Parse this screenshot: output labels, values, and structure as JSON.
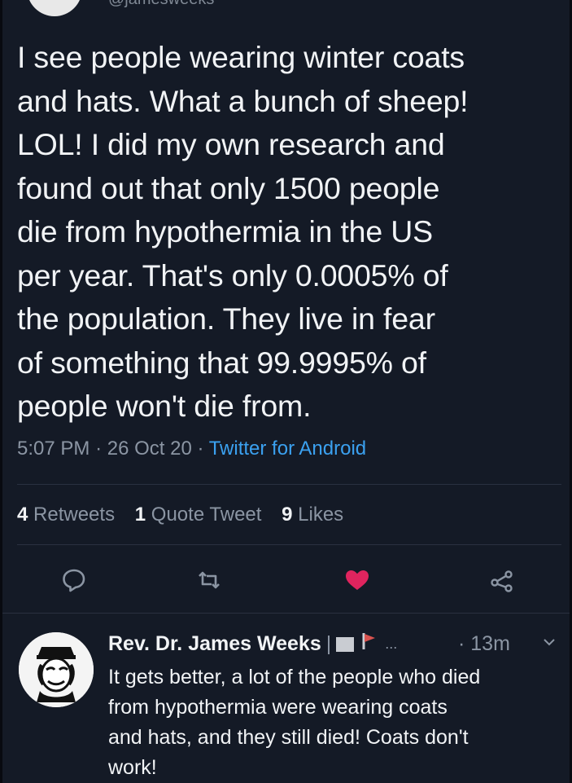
{
  "tweet": {
    "handle": "@jamesweeks",
    "text": "I see people wearing winter coats\nand hats. What a bunch of sheep!\nLOL! I did my own research and\nfound out that only 1500 people\ndie from hypothermia in the US\nper year. That's only 0.0005% of\nthe population. They live in fear\nof something that 99.9995% of\npeople won't die from.",
    "time": "5:07 PM",
    "date": "26 Oct 20",
    "source": "Twitter for Android",
    "stats": {
      "retweets_count": "4",
      "retweets_label": "Retweets",
      "quotes_count": "1",
      "quotes_label": "Quote Tweet",
      "likes_count": "9",
      "likes_label": "Likes"
    },
    "actions": {
      "reply_icon": "reply-icon",
      "retweet_icon": "retweet-icon",
      "like_icon": "heart-icon",
      "share_icon": "share-icon",
      "like_color": "#e0245e"
    }
  },
  "reply": {
    "name": "Rev. Dr. James Weeks",
    "separator": "|",
    "ellipsis": "...",
    "time": "· 13m",
    "text": "It gets better, a lot of the people who died\nfrom hypothermia were wearing coats\nand hats, and they still died! Coats don't\nwork!"
  },
  "colors": {
    "background": "#141a26",
    "text": "#f1f3f5",
    "muted": "#8b95a3",
    "link": "#3ba1f0"
  }
}
